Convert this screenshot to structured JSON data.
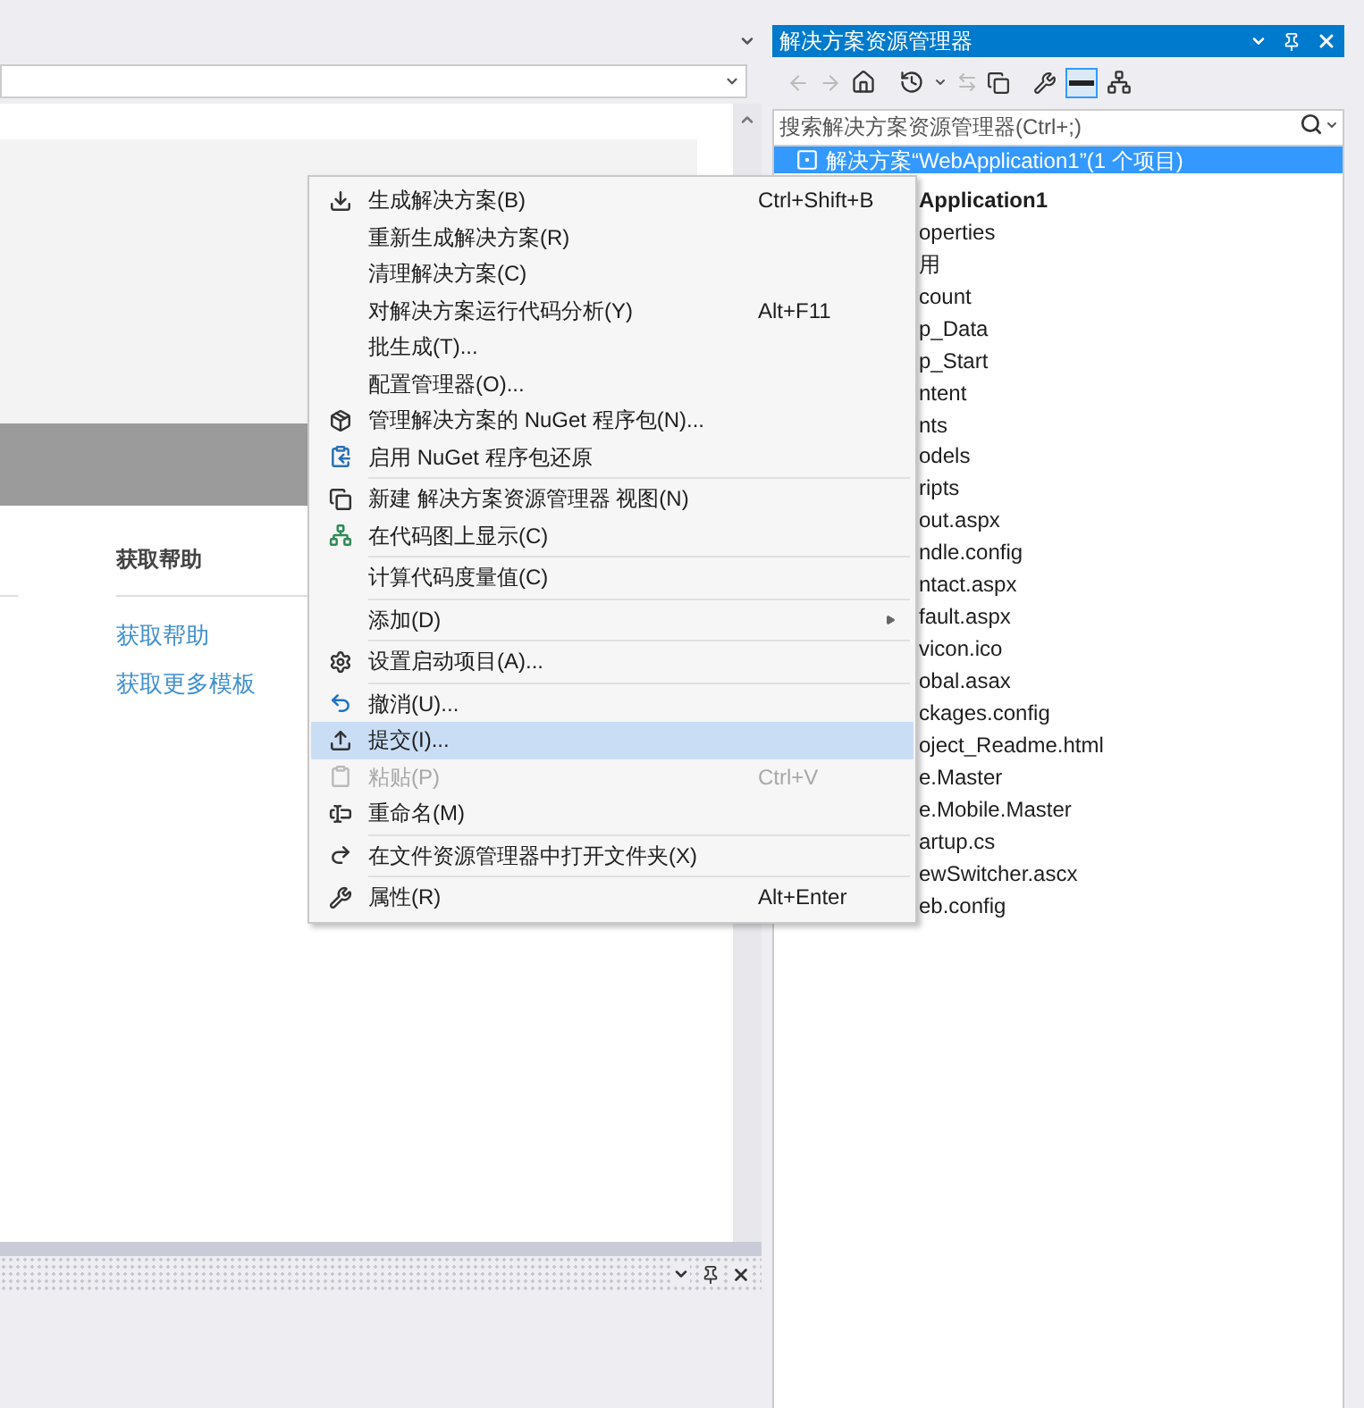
{
  "editor": {
    "help": {
      "heading": "获取帮助",
      "links": [
        "获取帮助",
        "获取更多模板"
      ]
    }
  },
  "solution_explorer": {
    "title": "解决方案资源管理器",
    "search": {
      "placeholder": "搜索解决方案资源管理器(Ctrl+;)"
    },
    "tree": [
      {
        "kind": "solution",
        "label": "解决方案“WebApplication1”(1 个项目)",
        "selected": true
      },
      {
        "kind": "project",
        "label": "Application1",
        "selected": false
      },
      {
        "kind": "item",
        "label": "operties",
        "selected": false
      },
      {
        "kind": "item",
        "label": "用",
        "selected": false
      },
      {
        "kind": "item",
        "label": "count",
        "selected": false
      },
      {
        "kind": "item",
        "label": "p_Data",
        "selected": false
      },
      {
        "kind": "item",
        "label": "p_Start",
        "selected": false
      },
      {
        "kind": "item",
        "label": "ntent",
        "selected": false
      },
      {
        "kind": "item",
        "label": "nts",
        "selected": false
      },
      {
        "kind": "item",
        "label": "odels",
        "selected": false
      },
      {
        "kind": "item",
        "label": "ripts",
        "selected": false
      },
      {
        "kind": "item",
        "label": "out.aspx",
        "selected": false
      },
      {
        "kind": "item",
        "label": "ndle.config",
        "selected": false
      },
      {
        "kind": "item",
        "label": "ntact.aspx",
        "selected": false
      },
      {
        "kind": "item",
        "label": "fault.aspx",
        "selected": false
      },
      {
        "kind": "item",
        "label": "vicon.ico",
        "selected": false
      },
      {
        "kind": "item",
        "label": "obal.asax",
        "selected": false
      },
      {
        "kind": "item",
        "label": "ckages.config",
        "selected": false
      },
      {
        "kind": "item",
        "label": "oject_Readme.html",
        "selected": false
      },
      {
        "kind": "item",
        "label": "e.Master",
        "selected": false
      },
      {
        "kind": "item",
        "label": "e.Mobile.Master",
        "selected": false
      },
      {
        "kind": "item",
        "label": "artup.cs",
        "selected": false
      },
      {
        "kind": "item",
        "label": "ewSwitcher.ascx",
        "selected": false
      },
      {
        "kind": "item",
        "label": "eb.config",
        "selected": false
      }
    ]
  },
  "context_menu": {
    "items": [
      {
        "label": "生成解决方案(B)",
        "shortcut": "Ctrl+Shift+B",
        "separator_before": false,
        "disabled": false,
        "selected": false,
        "submenu": false
      },
      {
        "label": "重新生成解决方案(R)",
        "separator_before": false,
        "disabled": false,
        "selected": false,
        "submenu": false
      },
      {
        "label": "清理解决方案(C)",
        "separator_before": false,
        "disabled": false,
        "selected": false,
        "submenu": false
      },
      {
        "label": "对解决方案运行代码分析(Y)",
        "shortcut": "Alt+F11",
        "separator_before": false,
        "disabled": false,
        "selected": false,
        "submenu": false
      },
      {
        "label": "批生成(T)...",
        "separator_before": false,
        "disabled": false,
        "selected": false,
        "submenu": false
      },
      {
        "label": "配置管理器(O)...",
        "separator_before": false,
        "disabled": false,
        "selected": false,
        "submenu": false
      },
      {
        "label": "管理解决方案的 NuGet 程序包(N)...",
        "separator_before": false,
        "disabled": false,
        "selected": false,
        "submenu": false
      },
      {
        "label": "启用 NuGet 程序包还原",
        "separator_before": false,
        "disabled": false,
        "selected": false,
        "submenu": false
      },
      {
        "label": "新建 解决方案资源管理器 视图(N)",
        "separator_before": true,
        "disabled": false,
        "selected": false,
        "submenu": false
      },
      {
        "label": "在代码图上显示(C)",
        "separator_before": false,
        "disabled": false,
        "selected": false,
        "submenu": false
      },
      {
        "label": "计算代码度量值(C)",
        "separator_before": true,
        "disabled": false,
        "selected": false,
        "submenu": false
      },
      {
        "label": "添加(D)",
        "separator_before": true,
        "disabled": false,
        "selected": false,
        "submenu": true
      },
      {
        "label": "设置启动项目(A)...",
        "separator_before": true,
        "disabled": false,
        "selected": false,
        "submenu": false
      },
      {
        "label": "撤消(U)...",
        "separator_before": true,
        "disabled": false,
        "selected": false,
        "submenu": false
      },
      {
        "label": "提交(I)...",
        "separator_before": false,
        "disabled": false,
        "selected": true,
        "submenu": false
      },
      {
        "label": "粘贴(P)",
        "shortcut": "Ctrl+V",
        "separator_before": false,
        "disabled": true,
        "selected": false,
        "submenu": false
      },
      {
        "label": "重命名(M)",
        "separator_before": false,
        "disabled": false,
        "selected": false,
        "submenu": false
      },
      {
        "label": "在文件资源管理器中打开文件夹(X)",
        "separator_before": true,
        "disabled": false,
        "selected": false,
        "submenu": false
      },
      {
        "label": "属性(R)",
        "shortcut": "Alt+Enter",
        "separator_before": true,
        "disabled": false,
        "selected": false,
        "submenu": false
      }
    ]
  }
}
